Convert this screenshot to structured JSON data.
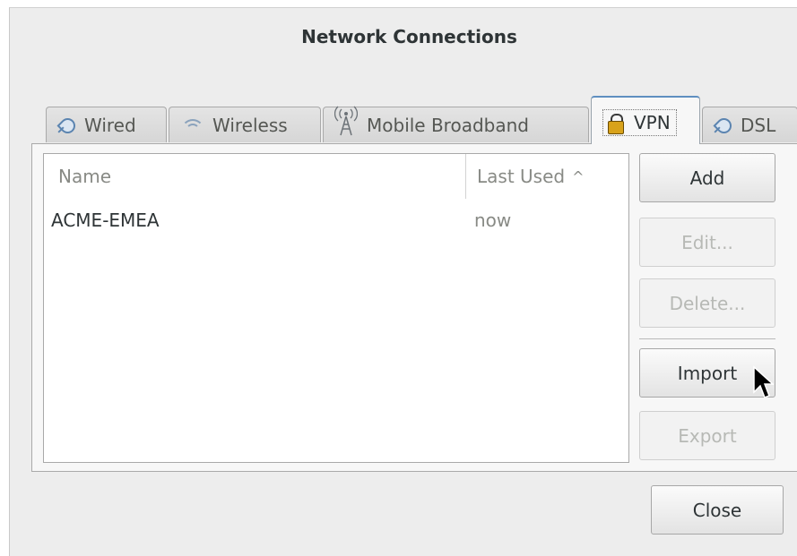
{
  "window": {
    "title": "Network Connections"
  },
  "tabs": [
    {
      "label": "Wired",
      "icon": "wired-icon"
    },
    {
      "label": "Wireless",
      "icon": "wireless-icon"
    },
    {
      "label": "Mobile Broadband",
      "icon": "mobile-broadband-icon"
    },
    {
      "label": "VPN",
      "icon": "lock-icon",
      "active": true
    },
    {
      "label": "DSL",
      "icon": "dsl-icon"
    }
  ],
  "list": {
    "columns": {
      "name": "Name",
      "last_used": "Last Used",
      "sort_indicator": "^"
    },
    "rows": [
      {
        "name": "ACME-EMEA",
        "last_used": "now"
      }
    ]
  },
  "buttons": {
    "add": "Add",
    "edit": "Edit...",
    "delete": "Delete...",
    "import": "Import",
    "export": "Export",
    "close": "Close"
  },
  "colors": {
    "active_tab_accent": "#5f8fc0",
    "lock_icon": "#d8a21a",
    "plug_icon": "#5b84b0"
  }
}
